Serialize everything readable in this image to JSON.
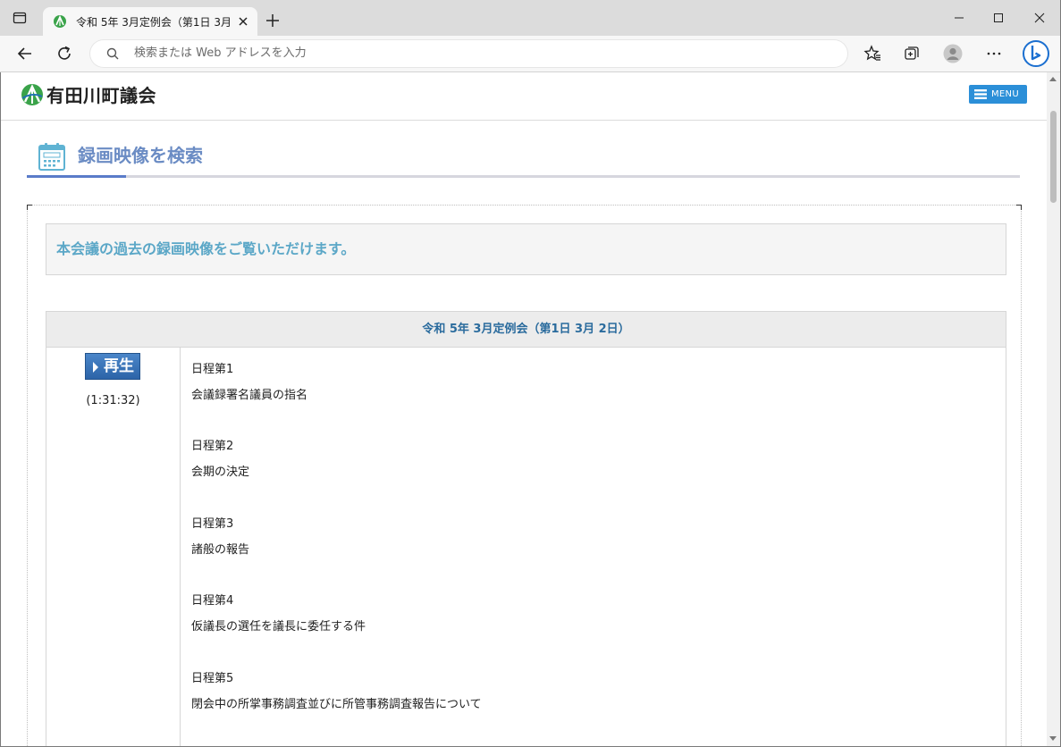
{
  "browser": {
    "tab_title": "令和 5年 3月定例会（第1日 3月 2日）",
    "address_placeholder": "検索または Web アドレスを入力"
  },
  "site": {
    "name": "有田川町議会",
    "menu_label": "MENU"
  },
  "page": {
    "section_title": "録画映像を検索",
    "intro": "本会議の過去の録画映像をご覧いただけます。",
    "meeting": {
      "title": "令和 5年 3月定例会（第1日 3月 2日）",
      "play_label": "再生",
      "duration": "(1:31:32)",
      "agenda": [
        {
          "number": "日程第1",
          "description": "会議録署名議員の指名"
        },
        {
          "number": "日程第2",
          "description": "会期の決定"
        },
        {
          "number": "日程第3",
          "description": "諸般の報告"
        },
        {
          "number": "日程第4",
          "description": "仮議長の選任を議長に委任する件"
        },
        {
          "number": "日程第5",
          "description": "閉会中の所掌事務調査並びに所管事務調査報告について"
        }
      ]
    }
  },
  "colors": {
    "accent_blue": "#2b8fd8",
    "title_blue": "#6b8cc4",
    "intro_text": "#5ba7c7",
    "meeting_title": "#2a6b9d",
    "play_button": "#3c74b9"
  }
}
